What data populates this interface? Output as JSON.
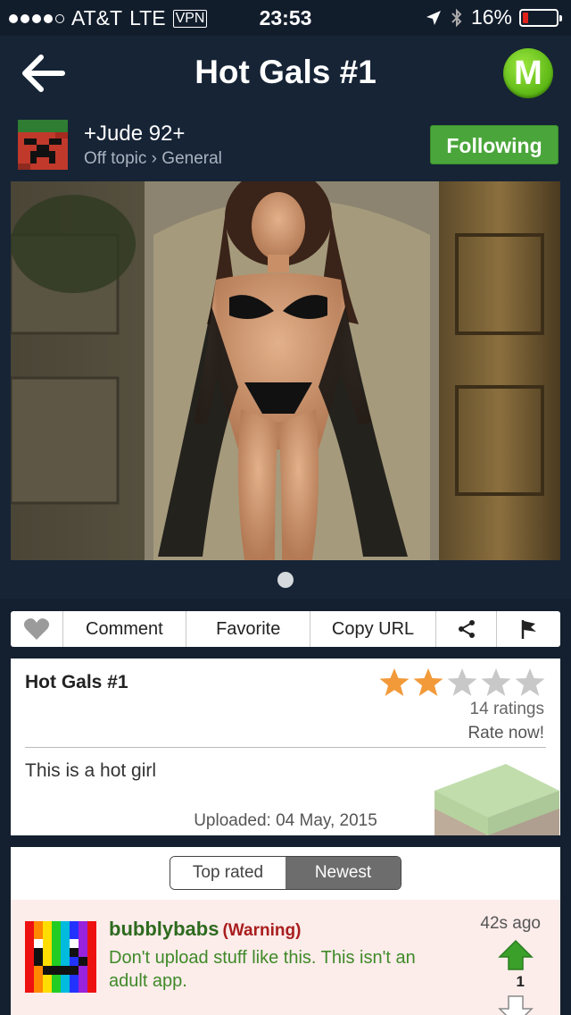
{
  "status_bar": {
    "carrier": "AT&T",
    "network": "LTE",
    "vpn": "VPN",
    "time": "23:53",
    "battery": "16%",
    "battery_level": 0.16
  },
  "nav": {
    "title": "Hot Gals #1",
    "logo_letter": "M"
  },
  "author": {
    "name": "+Jude 92+",
    "category": "Off topic › General",
    "follow_label": "Following"
  },
  "gallery": {
    "pages": 1,
    "current_page": 1
  },
  "actions": {
    "comment": "Comment",
    "favorite": "Favorite",
    "copy_url": "Copy URL"
  },
  "post": {
    "title": "Hot Gals #1",
    "rating": 2,
    "max_rating": 5,
    "ratings_count": "14 ratings",
    "rate_now": "Rate now!",
    "description": "This is a hot girl",
    "uploaded": "Uploaded: 04 May, 2015"
  },
  "comments": {
    "sort_top": "Top rated",
    "sort_newest": "Newest",
    "items": [
      {
        "user": "bubblybabs",
        "flag": "(Warning)",
        "text": "Don't upload stuff like this. This isn't an adult app.",
        "time": "42s ago",
        "votes": "1"
      }
    ]
  },
  "colors": {
    "background": "#162436",
    "follow_green": "#4aa63a",
    "star_filled": "#f29a3a",
    "star_empty": "#c8c8c8",
    "username_green": "#2d6a1e",
    "warning_red": "#a81e1e"
  }
}
